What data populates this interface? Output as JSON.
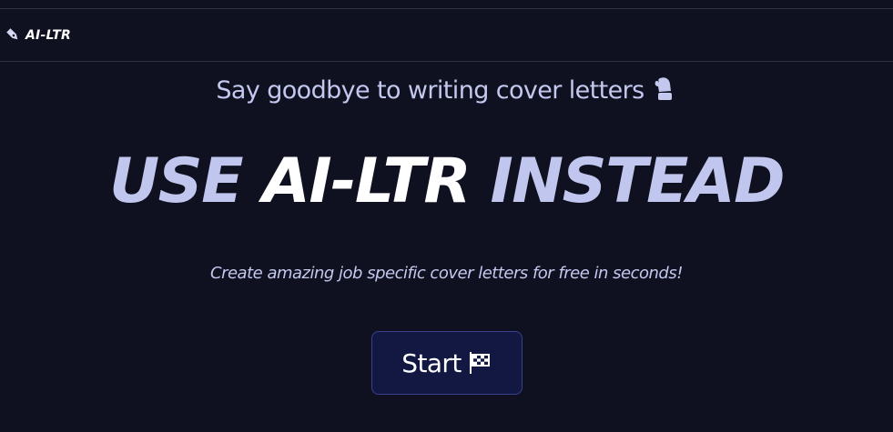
{
  "brand": {
    "name": "AI-LTR",
    "icon": "pen-nib-icon"
  },
  "hero": {
    "tagline": "Say goodbye to writing cover letters",
    "tagline_icon": "mitten-icon",
    "headline": {
      "part1": "USE",
      "part2": "AI-LTR",
      "part3": "INSTEAD"
    },
    "subtitle": "Create amazing job specific cover letters for free in seconds!"
  },
  "cta": {
    "label": "Start",
    "icon": "checkered-flag-icon"
  },
  "colors": {
    "background": "#0f1120",
    "accent_text": "#c1c6ee",
    "button_bg": "#131842",
    "button_border": "#3a3f8e"
  }
}
